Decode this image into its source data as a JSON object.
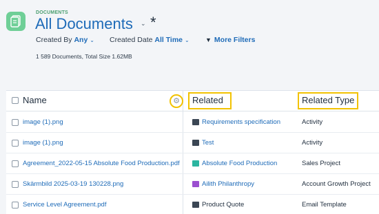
{
  "header": {
    "eyebrow": "DOCUMENTS",
    "title": "All Documents",
    "title_chevron": "⌄",
    "unsaved_marker": "*"
  },
  "filters": {
    "created_by": {
      "label": "Created By",
      "value": "Any"
    },
    "created_date": {
      "label": "Created Date",
      "value": "All Time"
    },
    "more_filters_label": "More Filters",
    "chevron": "⌄"
  },
  "summary": "1 589 Documents, Total Size 1.62MB",
  "table": {
    "columns": {
      "name": "Name",
      "related": "Related",
      "related_type": "Related Type"
    },
    "rows": [
      {
        "name": "image (1).png",
        "related": "Requirements specification",
        "related_icon": "envelope-icon",
        "related_icon_color": "#3b4654",
        "related_is_link": true,
        "related_type": "Activity"
      },
      {
        "name": "image (1).png",
        "related": "Test",
        "related_icon": "envelope-icon",
        "related_icon_color": "#3b4654",
        "related_is_link": true,
        "related_type": "Activity"
      },
      {
        "name": "Agreement_2022-05-15 Absolute Food Production.pdf",
        "related": "Absolute Food Production",
        "related_icon": "sales-project-icon",
        "related_icon_color": "#2bb5a0",
        "related_is_link": true,
        "related_type": "Sales Project"
      },
      {
        "name": "Skärmbild 2025-03-19 130228.png",
        "related": "Ailith Philanthropy",
        "related_icon": "briefcase-icon",
        "related_icon_color": "#9b4fd0",
        "related_is_link": true,
        "related_type": "Account Growth Project"
      },
      {
        "name": "Service Level Agreement.pdf",
        "related": "Product Quote",
        "related_icon": "envelope-icon",
        "related_icon_color": "#3b4654",
        "related_is_link": false,
        "related_type": "Email Template"
      }
    ]
  },
  "colors": {
    "accent": "#1e6bb8",
    "highlight": "#f2c200",
    "app_icon": "#6fcf97"
  }
}
